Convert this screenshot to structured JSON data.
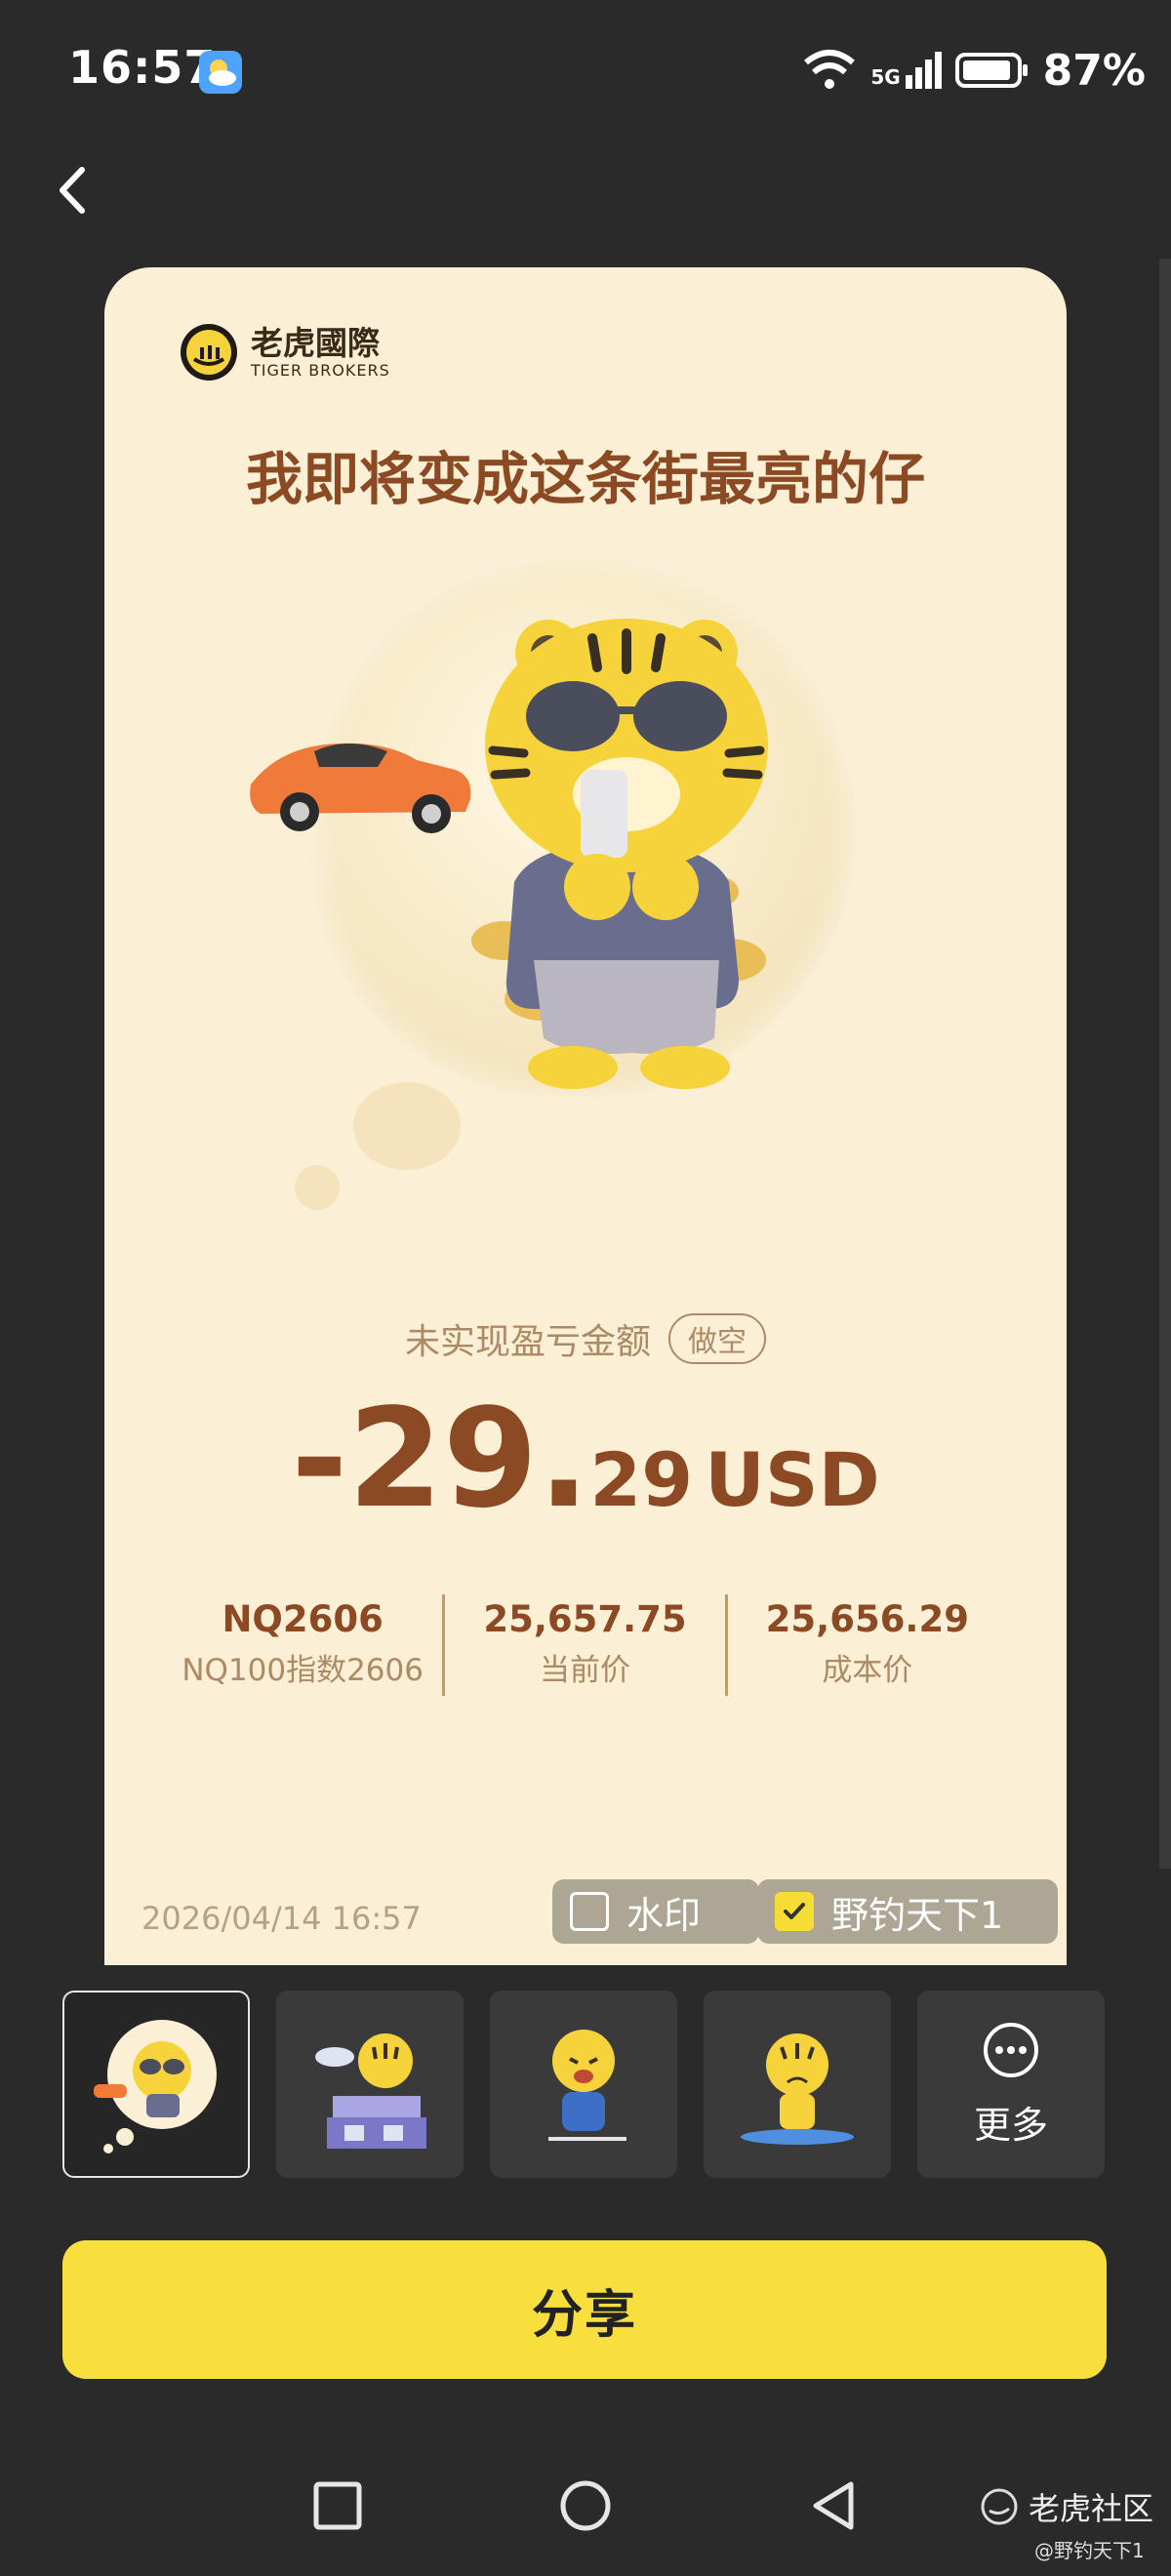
{
  "status_bar": {
    "time": "16:57",
    "network": "5G",
    "battery": "87%"
  },
  "card": {
    "brand_name": "老虎國際",
    "brand_sub": "TIGER BROKERS",
    "headline": "我即将变成这条街最亮的仔",
    "pl_label": "未实现盈亏金额",
    "direction_badge": "做空",
    "amount_int": "-29.",
    "amount_dec": "29",
    "amount_currency": "USD",
    "stats": [
      {
        "value": "NQ2606",
        "label": "NQ100指数2606"
      },
      {
        "value": "25,657.75",
        "label": "当前价"
      },
      {
        "value": "25,656.29",
        "label": "成本价"
      }
    ],
    "timestamp": "2026/04/14 16:57",
    "watermark_label": "水印",
    "name_label": "野钓天下1"
  },
  "thumbnails": {
    "more_label": "更多"
  },
  "share_label": "分享",
  "community": {
    "name": "老虎社区",
    "user": "@野钓天下1"
  },
  "colors": {
    "card_bg": "#fbf0d6",
    "accent_text": "#8b4a24",
    "share_button": "#f8df3e"
  }
}
